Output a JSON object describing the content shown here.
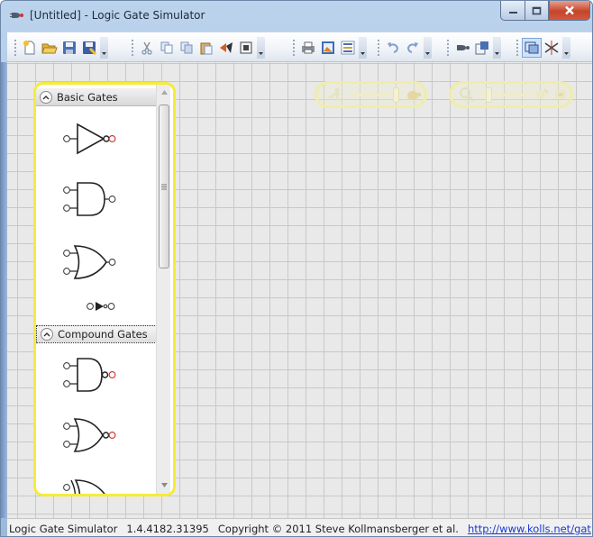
{
  "window": {
    "title": "[Untitled] - Logic Gate Simulator",
    "icon": "gate-app-icon"
  },
  "caption_buttons": [
    "minimize-icon",
    "maximize-icon",
    "close-icon"
  ],
  "toolbar": {
    "groups": [
      [
        "new-icon",
        "open-icon",
        "save-icon",
        "save-as-icon"
      ],
      [
        "cut-icon",
        "copy-icon",
        "copy-image-icon",
        "paste-icon",
        "flip-icon",
        "ic-icon"
      ],
      [
        "print-icon",
        "image-icon",
        "export-icon"
      ],
      [
        "undo-icon",
        "redo-icon"
      ],
      [
        "gate-icon",
        "wizard-icon"
      ],
      [
        "select-icon",
        "wire-cut-icon"
      ]
    ],
    "pressed": "select-icon"
  },
  "toolbox": {
    "groups": [
      {
        "label": "Basic Gates",
        "gates": [
          "not-gate",
          "and-gate",
          "or-gate",
          "buffer-gate"
        ]
      },
      {
        "label": "Compound Gates",
        "gates": [
          "nand-gate",
          "nor-gate",
          "xor-gate"
        ]
      }
    ]
  },
  "sliders": [
    {
      "name": "speed-slider",
      "icons": [
        "runner-icon",
        "turtle-icon"
      ],
      "level": 0.8
    },
    {
      "name": "zoom-slider",
      "icons": [
        "zoom-icon",
        "fit-icon",
        "reset-icon"
      ],
      "level": 0.15
    }
  ],
  "status": {
    "app_name": "Logic Gate Simulator",
    "version": "1.4.4182.31395",
    "copyright": "Copyright © 2011 Steve Kollmansberger et al.",
    "url": "http://www.kolls.net/gat"
  },
  "colors": {
    "toolbox_border": "#f5ec38",
    "grid_line": "#c8c8c8",
    "canvas_bg": "#e9e9e9",
    "link": "#1a39d6",
    "output_pin": "#cc2b2b"
  }
}
